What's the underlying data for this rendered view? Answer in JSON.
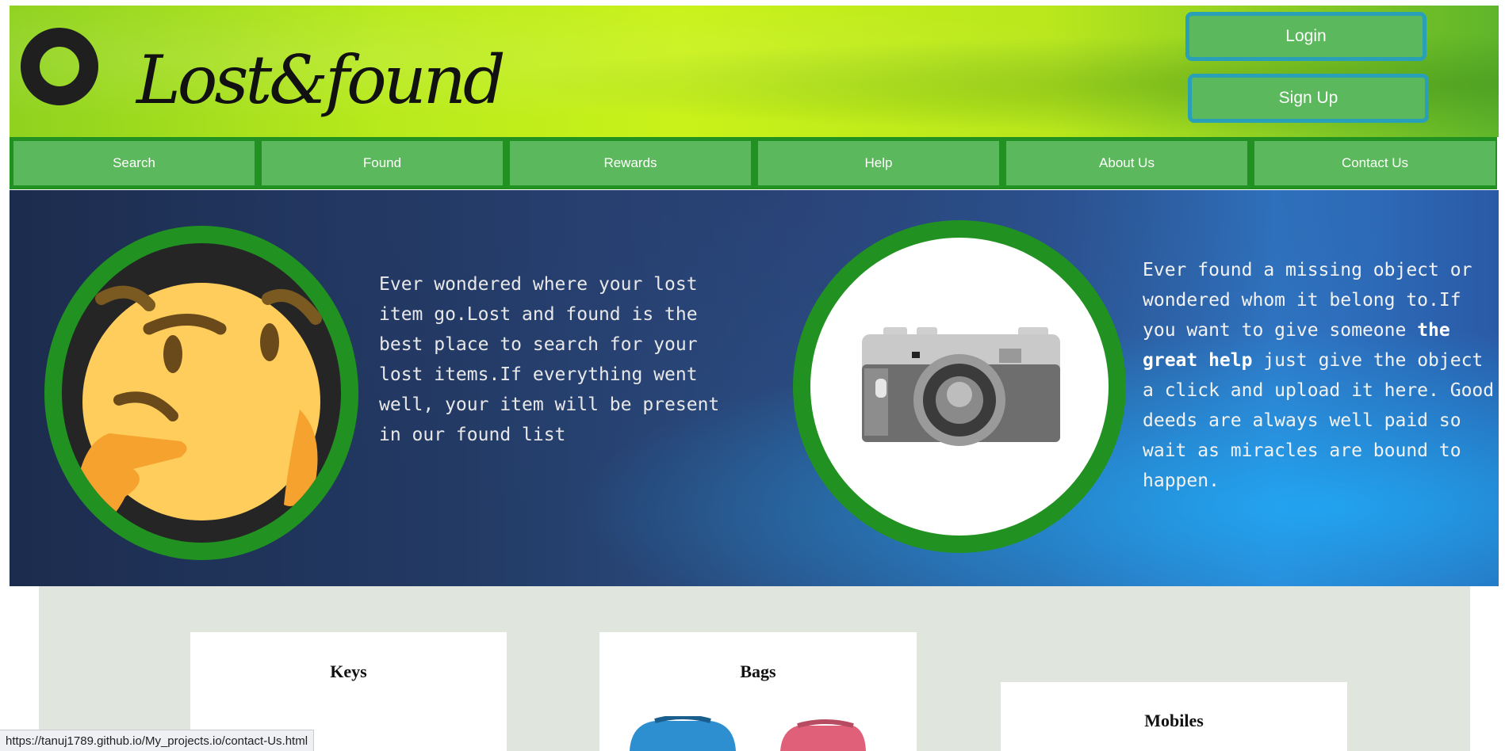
{
  "header": {
    "logo_text": "Lost&found",
    "login_label": "Login",
    "signup_label": "Sign Up"
  },
  "nav": {
    "items": [
      "Search",
      "Found",
      "Rewards",
      "Help",
      "About Us",
      "Contact Us"
    ]
  },
  "hero": {
    "left_text": "Ever wondered where your lost item go.Lost and found is the best place to search for your lost items.If everything went well, your item will be present in our found list",
    "right_text_before": "Ever found a missing object or wondered whom it belong to.If you want to give someone ",
    "right_text_bold": "the great help",
    "right_text_after": " just give the object a click and upload it here. Good deeds are always well paid so wait as miracles are bound to happen."
  },
  "categories": [
    {
      "title": "Keys"
    },
    {
      "title": "Bags"
    },
    {
      "title": "Mobiles"
    }
  ],
  "status_bar": {
    "url": "https://tanuj1789.github.io/My_projects.io/contact-Us.html"
  },
  "colors": {
    "nav_green": "#219221",
    "button_green": "#5cb85c",
    "button_border": "#2a9fb8"
  }
}
